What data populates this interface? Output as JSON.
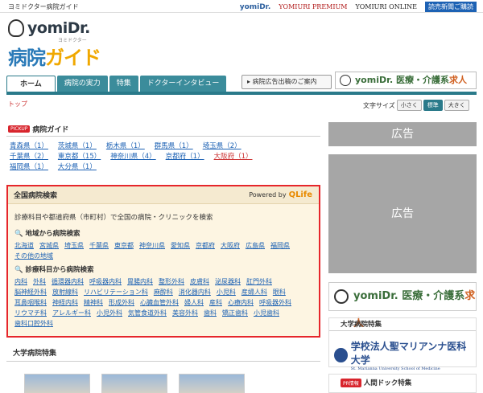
{
  "topbar": {
    "site_name": "ヨミドクター病院ガイド",
    "links": [
      "yomiDr.",
      "YOMIURI PREMIUM",
      "YOMIURI ONLINE"
    ],
    "subscribe": "読売新聞ご購読"
  },
  "logo": {
    "brand": "yomiDr.",
    "brand_sub": "ヨミドクター",
    "title_kanji": "病院",
    "title_kana": "ガイド"
  },
  "nav": {
    "tabs": [
      "ホーム",
      "病院の実力",
      "特集",
      "ドクターインタビュー"
    ],
    "ad_button": "病院広告出稿のご案内",
    "job_banner": {
      "brand": "yomiDr.",
      "text1": "医療・介護系",
      "text2": "求人"
    }
  },
  "breadcrumb": "トップ",
  "font_size": {
    "label": "文字サイズ",
    "options": [
      "小さく",
      "標準",
      "大きく"
    ]
  },
  "pickup": {
    "badge": "PICKUP",
    "title": "病院ガイド",
    "prefs": [
      "青森県（1）",
      "茨城県（1）",
      "栃木県（1）",
      "群馬県（1）",
      "埼玉県（2）",
      "千葉県（2）",
      "東京都（15）",
      "神奈川県（4）",
      "京都府（1）",
      "大阪府（1）",
      "福岡県（1）",
      "大分県（1）"
    ]
  },
  "search": {
    "title": "全国病院検索",
    "powered_by": "Powered by",
    "powered_brand": "QLife",
    "intro": "診療科目や都道府県（市町村）で全国の病院・クリニックを検索",
    "region_title": "地域から病院検索",
    "regions": [
      "北海道",
      "宮城県",
      "埼玉県",
      "千葉県",
      "東京都",
      "神奈川県",
      "愛知県",
      "京都府",
      "大阪府",
      "広島県",
      "福岡県",
      "その他の地域"
    ],
    "dept_title": "診療科目から病院検索",
    "depts": [
      "内科",
      "外科",
      "循環器内科",
      "呼吸器内科",
      "胃腸内科",
      "整形外科",
      "皮膚科",
      "泌尿器科",
      "肛門外科",
      "脳神経外科",
      "放射線科",
      "リハビリテーション科",
      "麻酔科",
      "消化器内科",
      "小児科",
      "産婦人科",
      "眼科",
      "耳鼻咽喉科",
      "神経内科",
      "精神科",
      "形成外科",
      "心臓血管外科",
      "婦人科",
      "産科",
      "心療内科",
      "呼吸器外科",
      "リウマチ科",
      "アレルギー科",
      "小児外科",
      "気管食道外科",
      "美容外科",
      "歯科",
      "矯正歯科",
      "小児歯科",
      "歯科口腔外科"
    ]
  },
  "university": {
    "title": "大学病院特集"
  },
  "right": {
    "ad1": "広告",
    "ad2": "広告",
    "job_big": {
      "brand": "yomiDr.",
      "text1": "医療・介護系",
      "text2": "求人"
    },
    "uni_box_title": "大学病院特集",
    "uni_name": "学校法人聖マリアンナ医科大学",
    "uni_name_en": "St. Marianna University School of Medicine",
    "dock_badge": "PR情報",
    "dock_title": "人間ドック特集"
  },
  "colors": {
    "accent": "#2a7a8a",
    "link": "#1d62b4",
    "highlight_border": "#e6262b",
    "ad_gray": "#a6a6a6"
  }
}
